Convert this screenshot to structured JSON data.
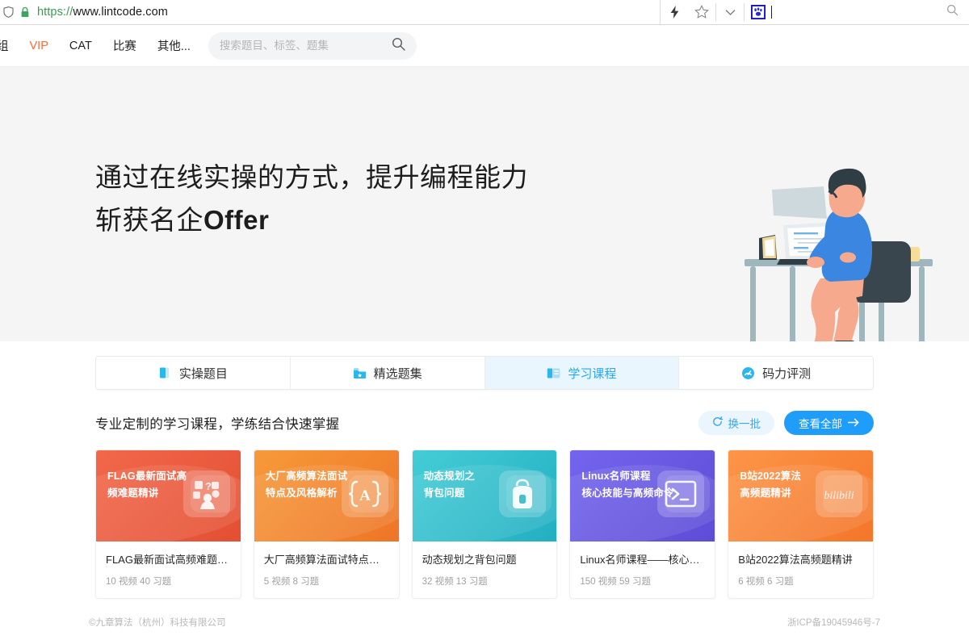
{
  "browser": {
    "url_scheme": "https://",
    "url_host": "www.lintcode.com",
    "lock_icon": "lock-icon",
    "shield_icon": "shield-icon",
    "lightning_icon": "lightning-icon",
    "star_icon": "star-bookmark-icon",
    "chevron_icon": "chevron-down-icon",
    "favicon": "baidu-paw-favicon",
    "search_placeholder": "",
    "search_value": "",
    "search_icon": "search-icon"
  },
  "nav": {
    "items": [
      {
        "label": "组",
        "style": "normal",
        "name": "sidebar-item-group"
      },
      {
        "label": "VIP",
        "style": "vip",
        "name": "nav-item-vip"
      },
      {
        "label": "CAT",
        "style": "normal",
        "name": "nav-item-cat"
      },
      {
        "label": "比赛",
        "style": "normal",
        "name": "nav-item-contest"
      },
      {
        "label": "其他...",
        "style": "normal",
        "name": "nav-item-more"
      }
    ],
    "search_placeholder": "搜索题目、标签、题集",
    "search_value": "",
    "search_icon": "search-icon"
  },
  "hero": {
    "line1": "通过在线实操的方式，提升编程能力",
    "line2_cn": "斩获名企",
    "line2_en": "Offer",
    "illustration": "person-at-desk-with-laptop-illustration",
    "bg_color": "#f5f5f5"
  },
  "tabs": [
    {
      "label": "实操题目",
      "icon": "book-icon",
      "active": false
    },
    {
      "label": "精选题集",
      "icon": "folder-star-icon",
      "active": false
    },
    {
      "label": "学习课程",
      "icon": "course-card-icon",
      "active": true
    },
    {
      "label": "码力评测",
      "icon": "gauge-icon",
      "active": false
    }
  ],
  "section": {
    "title": "专业定制的学习课程，学练结合快速掌握",
    "refresh_label": "换一批",
    "refresh_icon": "refresh-icon",
    "view_all_label": "查看全部",
    "view_all_icon": "arrow-right-icon"
  },
  "cards": [
    {
      "banner_line1": "FLAG最新面试高",
      "banner_line2": "频难题精讲",
      "title": "FLAG最新面试高频难题精讲",
      "meta": "10 视频  40 习题",
      "videos": 10,
      "exercises": 40,
      "badge_icon": "interview-chat-icon",
      "color_from": "#f05a3c",
      "color_to": "#e8563a"
    },
    {
      "banner_line1": "大厂高频算法面试",
      "banner_line2": "特点及风格解析",
      "title": "大厂高频算法面试特点及风...",
      "meta": "5 视频  8 习题",
      "videos": 5,
      "exercises": 8,
      "badge_icon": "brackets-a-icon",
      "color_from": "#f5922e",
      "color_to": "#ef7b2c"
    },
    {
      "banner_line1": "动态规划之",
      "banner_line2": "背包问题",
      "title": "动态规划之背包问题",
      "meta": "32 视频  13 习题",
      "videos": 32,
      "exercises": 13,
      "badge_icon": "backpack-icon",
      "color_from": "#3fc8d2",
      "color_to": "#2bb6c6"
    },
    {
      "banner_line1": "Linux名师课程",
      "banner_line2": "核心技能与高频命令",
      "title": "Linux名师课程——核心技...",
      "meta": "150 视频  59 习题",
      "videos": 150,
      "exercises": 59,
      "badge_icon": "terminal-prompt-icon",
      "color_from": "#6d5fe8",
      "color_to": "#6252dd"
    },
    {
      "banner_line1": "B站2022算法",
      "banner_line2": "高频题精讲",
      "title": "B站2022算法高频题精讲",
      "meta": "6 视频  6 习题",
      "videos": 6,
      "exercises": 6,
      "badge_icon": "bilibili-logo-icon",
      "color_from": "#fb8c3c",
      "color_to": "#f5792e"
    }
  ],
  "footer": {
    "copyright": "©九章算法（杭州）科技有限公司",
    "icp": "浙ICP备19045946号-7"
  },
  "colors": {
    "accent_blue": "#1e9efa",
    "accent_light_blue": "#eaf5fe",
    "vip_orange": "#ff6a3d",
    "hero_bg": "#f5f5f5"
  }
}
